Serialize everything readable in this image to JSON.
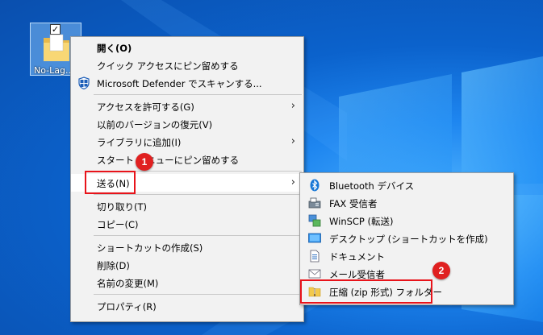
{
  "desktop": {
    "icon_label": "No-Lag..."
  },
  "main_menu": {
    "items": [
      {
        "label": "開く(O)",
        "bold": true
      },
      {
        "label": "クイック アクセスにピン留めする"
      },
      {
        "label": "Microsoft Defender でスキャンする..."
      },
      {
        "label": "アクセスを許可する(G)"
      },
      {
        "label": "以前のバージョンの復元(V)"
      },
      {
        "label": "ライブラリに追加(I)"
      },
      {
        "label": "スタート メニューにピン留めする"
      },
      {
        "label": "送る(N)"
      },
      {
        "label": "切り取り(T)"
      },
      {
        "label": "コピー(C)"
      },
      {
        "label": "ショートカットの作成(S)"
      },
      {
        "label": "削除(D)"
      },
      {
        "label": "名前の変更(M)"
      },
      {
        "label": "プロパティ(R)"
      }
    ]
  },
  "send_to_menu": {
    "items": [
      {
        "label": "Bluetooth デバイス",
        "icon": "bluetooth-icon"
      },
      {
        "label": "FAX 受信者",
        "icon": "fax-icon"
      },
      {
        "label": "WinSCP (転送)",
        "icon": "winscp-icon"
      },
      {
        "label": "デスクトップ (ショートカットを作成)",
        "icon": "desktop-icon"
      },
      {
        "label": "ドキュメント",
        "icon": "document-icon"
      },
      {
        "label": "メール受信者",
        "icon": "mail-icon"
      },
      {
        "label": "圧縮 (zip 形式) フォルダー",
        "icon": "zip-folder-icon"
      }
    ]
  },
  "annotations": {
    "badge_1": "1",
    "badge_2": "2",
    "highlight_color": "#e8131a"
  },
  "colors": {
    "desktop_blue": "#0b62cc",
    "menu_bg": "#f2f2f2"
  }
}
